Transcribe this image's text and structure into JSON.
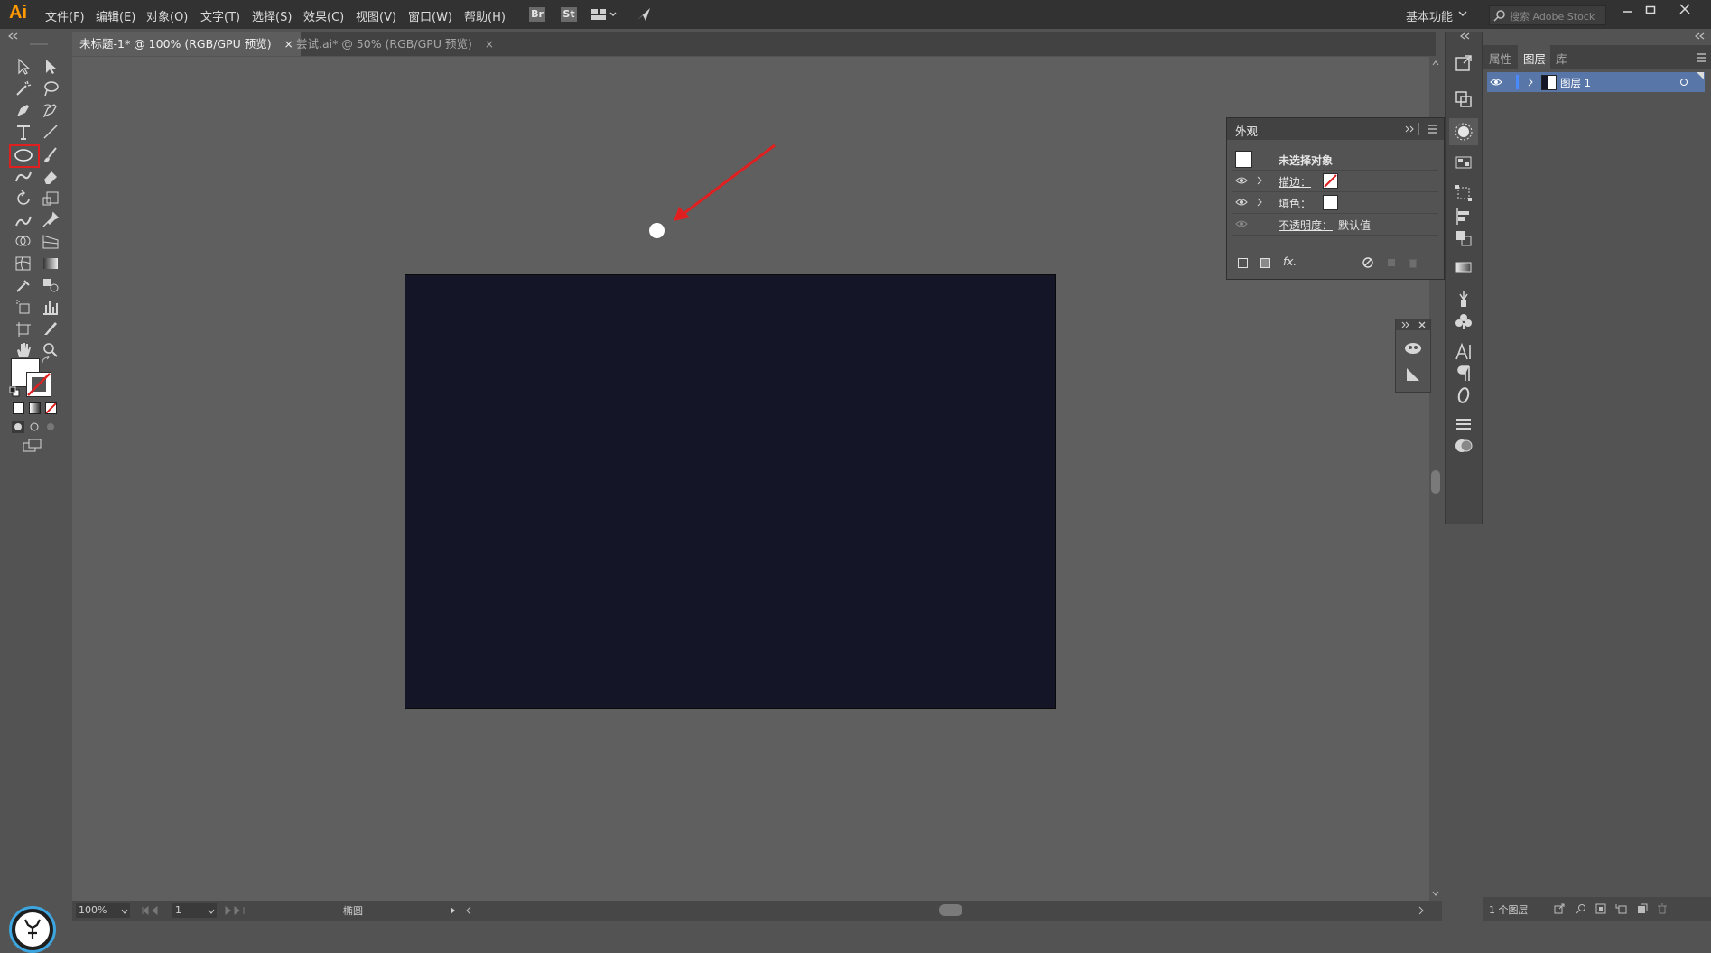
{
  "app": {
    "logo": "Ai",
    "workspace_label": "基本功能",
    "search_placeholder": "搜索 Adobe Stock"
  },
  "menu": [
    "文件(F)",
    "编辑(E)",
    "对象(O)",
    "文字(T)",
    "选择(S)",
    "效果(C)",
    "视图(V)",
    "窗口(W)",
    "帮助(H)"
  ],
  "top_badges": {
    "bridge": "Br",
    "stock": "St"
  },
  "tabs": [
    {
      "label": "未标题-1* @ 100% (RGB/GPU 预览)",
      "close": "×"
    },
    {
      "label": "尝试.ai* @ 50% (RGB/GPU 预览)",
      "close": "×"
    }
  ],
  "appearance": {
    "title": "外观",
    "object_label": "未选择对象",
    "stroke_label": "描边：",
    "fill_label": "填色：",
    "opacity_label": "不透明度：",
    "opacity_value": "默认值",
    "fx_label": "fx."
  },
  "layers_panel": {
    "tabs": [
      "属性",
      "图层",
      "库"
    ],
    "layer_name": "图层 1",
    "count_label": "1 个图层"
  },
  "status": {
    "zoom": "100%",
    "page": "1",
    "tool_name": "椭圆"
  },
  "colors": {
    "artboard": "#141628",
    "accent_orange": "#ff9a00",
    "layer_highlight": "#5876a8",
    "annotation_arrow": "#e02020",
    "selected_tool_outline": "#e02020"
  }
}
